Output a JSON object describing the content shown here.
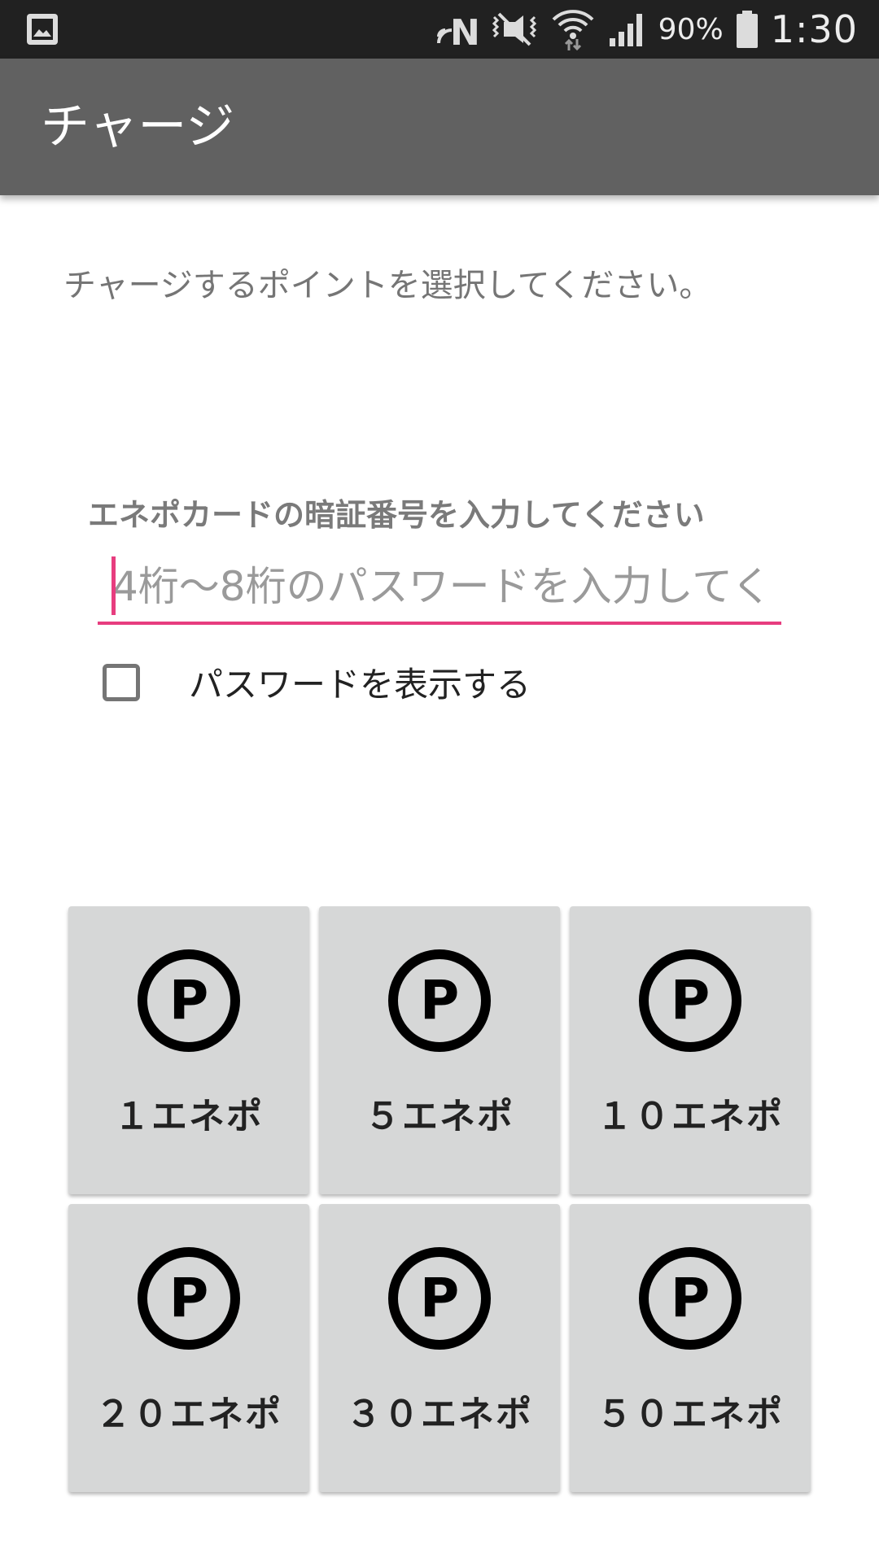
{
  "status_bar": {
    "left_icon": "gallery-icon",
    "icons": [
      "nfc-icon",
      "vibrate-mute-icon",
      "wifi-icon",
      "signal-icon",
      "battery-icon"
    ],
    "battery_percent": "90%",
    "time": "1:30"
  },
  "app_bar": {
    "title": "チャージ"
  },
  "content": {
    "instruction": "チャージするポイントを選択してください。",
    "pin_label": "エネポカードの暗証番号を入力してください",
    "pin_input": {
      "value": "",
      "placeholder": "4桁～8桁のパスワードを入力してく"
    },
    "show_password": {
      "label": "パスワードを表示する",
      "checked": false
    }
  },
  "charge_options": [
    {
      "label": "１エネポ",
      "icon": "point-p-icon"
    },
    {
      "label": "５エネポ",
      "icon": "point-p-icon"
    },
    {
      "label": "１０エネポ",
      "icon": "point-p-icon"
    },
    {
      "label": "２０エネポ",
      "icon": "point-p-icon"
    },
    {
      "label": "３０エネポ",
      "icon": "point-p-icon"
    },
    {
      "label": "５０エネポ",
      "icon": "point-p-icon"
    }
  ],
  "colors": {
    "status_bar": "#212121",
    "app_bar": "#616161",
    "accent": "#e73d7f",
    "tile": "#d6d7d7"
  }
}
